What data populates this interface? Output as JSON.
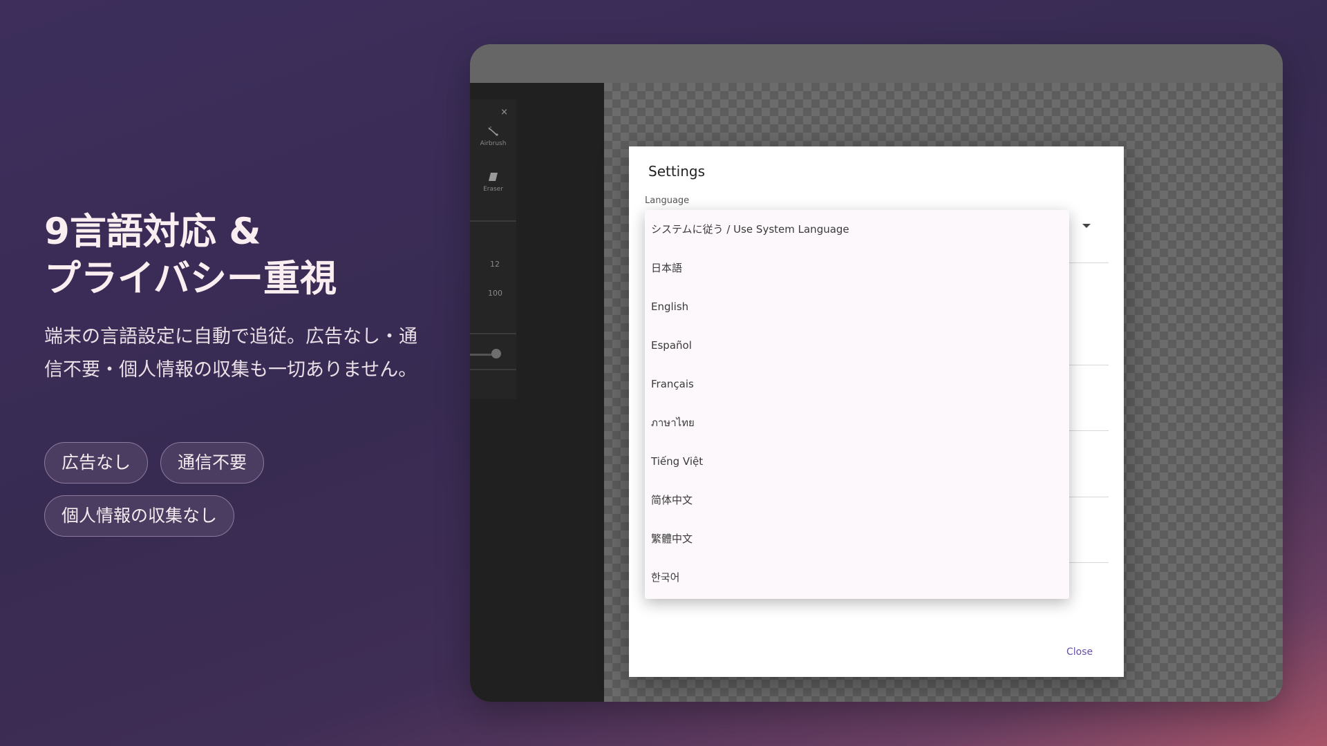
{
  "promo": {
    "headline_line1": "9言語対応 &",
    "headline_line2": "プライバシー重視",
    "description": "端末の言語設定に自動で追従。広告なし・通信不要・個人情報の収集も一切ありません。",
    "chips": [
      "広告なし",
      "通信不要",
      "個人情報の収集なし"
    ]
  },
  "tool_panel": {
    "close_glyph": "×",
    "tools": [
      {
        "label": "Airbrush",
        "icon": "airbrush-icon"
      },
      {
        "label": "Eraser",
        "icon": "eraser-icon"
      }
    ],
    "size_value": "12",
    "opacity_value": "100"
  },
  "settings_dialog": {
    "title": "Settings",
    "language_label": "Language",
    "close_label": "Close",
    "language_options": [
      "システムに従う / Use System Language",
      "日本語",
      "English",
      "Español",
      "Français",
      "ภาษาไทย",
      "Tiếng Việt",
      "简体中文",
      "繁體中文",
      "한국어"
    ]
  },
  "colors": {
    "background_top": "#3d2e5c",
    "background_bottom_right": "#a85468",
    "accent": "#6650a4",
    "dropdown_bg": "#fdf8fb"
  }
}
